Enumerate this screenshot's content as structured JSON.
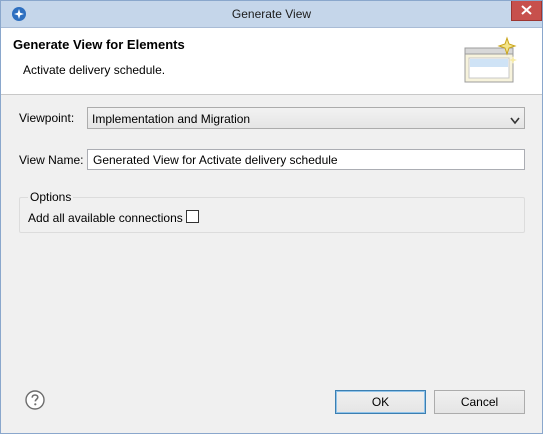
{
  "window": {
    "title": "Generate View"
  },
  "header": {
    "title": "Generate View for Elements",
    "description": "Activate delivery schedule."
  },
  "form": {
    "viewpoint_label": "Viewpoint:",
    "viewpoint_value": "Implementation and Migration",
    "view_name_label": "View Name:",
    "view_name_value": "Generated View for Activate delivery schedule"
  },
  "options": {
    "group_title": "Options",
    "add_connections_label": "Add all available connections",
    "add_connections_checked": false
  },
  "buttons": {
    "ok": "OK",
    "cancel": "Cancel"
  },
  "icons": {
    "app": "app-logo-icon",
    "close": "close-icon",
    "wizard": "view-wizard-icon",
    "help": "help-icon",
    "dropdown": "chevron-down-icon"
  },
  "colors": {
    "titlebar": "#c5d6ea",
    "close_button": "#c7504c",
    "dialog_background": "#f0f0f0",
    "header_background": "#ffffff",
    "default_button_border": "#3c7fb1"
  }
}
